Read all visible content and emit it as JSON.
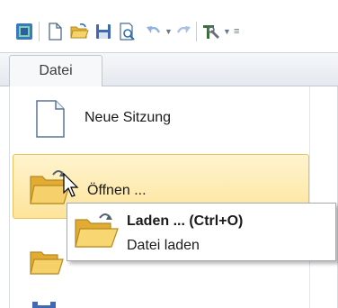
{
  "quick_access": {
    "icons": [
      "app-icon",
      "new-document-icon",
      "open-folder-icon",
      "save-icon",
      "print-preview-icon",
      "undo-icon",
      "redo-icon",
      "tools-icon"
    ]
  },
  "tabs": {
    "file_label": "Datei"
  },
  "menu": {
    "new_session_label": "Neue Sitzung",
    "open_label": "Öffnen ..."
  },
  "submenu": {
    "load_label": "Laden ... (Ctrl+O)",
    "load_description": "Datei laden"
  },
  "colors": {
    "highlight": "#fde49a",
    "highlight_border": "#e9c25b",
    "folder": "#f0c24a"
  }
}
